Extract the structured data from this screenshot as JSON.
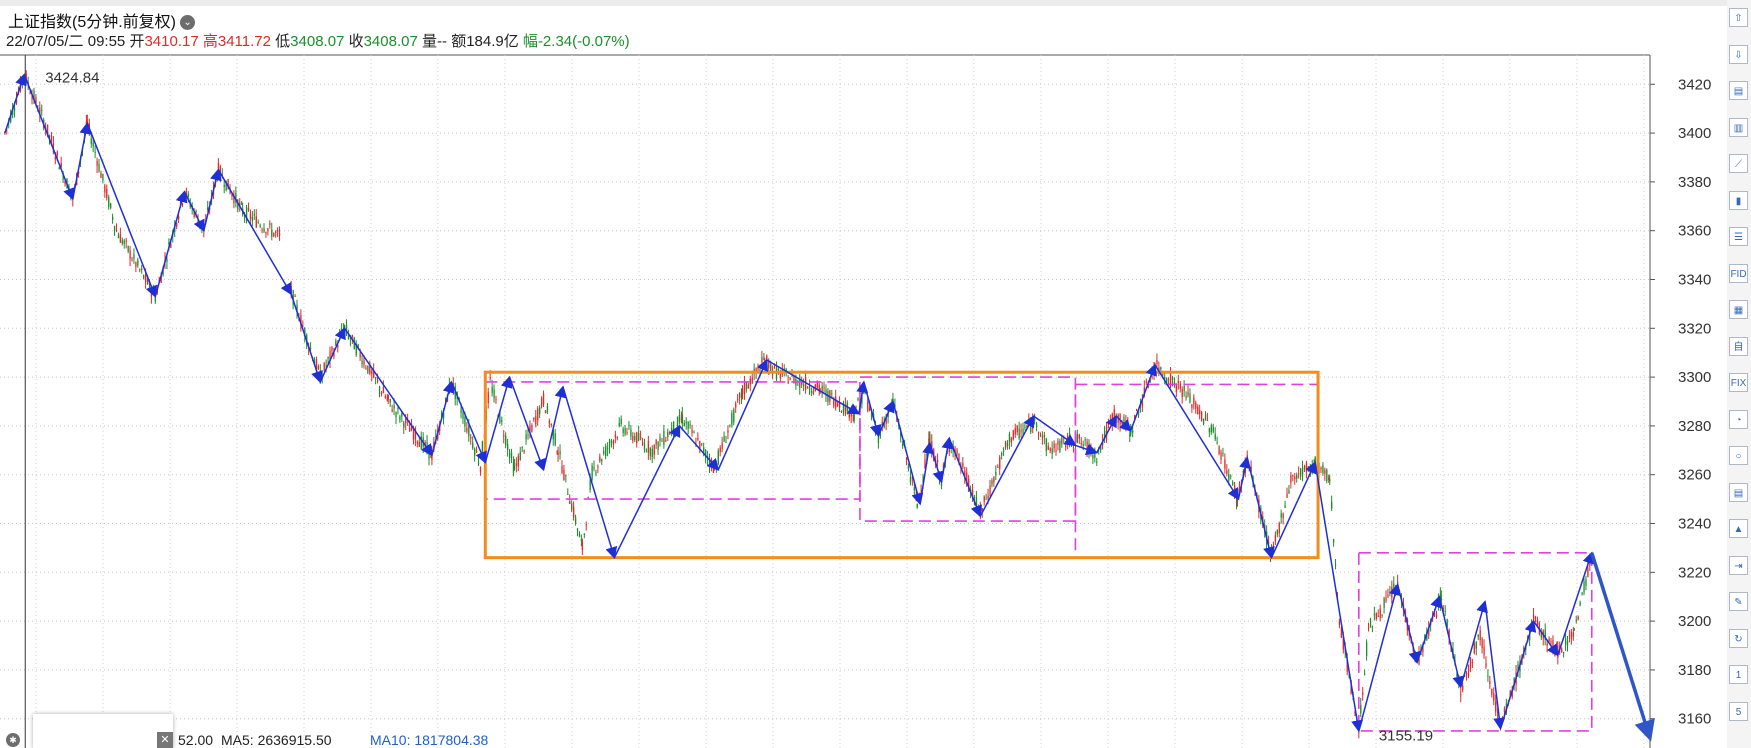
{
  "header": {
    "title": "上证指数(5分钟.前复权)",
    "datetime": "22/07/05/二 09:55",
    "open_label": "开",
    "open": "3410.17",
    "high_label": "高",
    "high": "3411.72",
    "low_label": "低",
    "low": "3408.07",
    "close_label": "收",
    "close": "3408.07",
    "volume_label": "量",
    "volume": "--",
    "amount_label": "额",
    "amount": "184.9亿",
    "change_label": "幅",
    "change": "-2.34(-0.07%)"
  },
  "volume_bar": {
    "partial": "52.00",
    "ma5": "MA5: 2636915.50",
    "ma10": "MA10: 1817804.38"
  },
  "colors": {
    "up": "#e02a2a",
    "down": "#1a8f2a",
    "wave": "#1f2fd6",
    "box": "#f28c1c",
    "dash": "#e040e0",
    "arrow": "#2f55c8"
  },
  "toolbar_items": [
    "⇧",
    "⇩",
    "▤",
    "▥",
    "⟋",
    "▮",
    "☰",
    "FID",
    "▦",
    "自",
    "FIX",
    "◔",
    "○",
    "▤",
    "▲",
    "⇥",
    "✎",
    "↻",
    "1",
    "5"
  ],
  "chart_data": {
    "type": "candlestick",
    "title": "上证指数(5分钟.前复权)",
    "ylim": [
      3148,
      3432
    ],
    "y_ticks": [
      3160,
      3180,
      3200,
      3220,
      3240,
      3260,
      3280,
      3300,
      3320,
      3340,
      3360,
      3380,
      3400,
      3420
    ],
    "grid": true,
    "annotations": [
      {
        "label": "3424.84",
        "x": 26,
        "y": 3424.84
      },
      {
        "label": "3155.19",
        "x": 1400,
        "y": 3155.19
      }
    ],
    "price_path": [
      [
        5,
        3400
      ],
      [
        25,
        3424
      ],
      [
        45,
        3405
      ],
      [
        75,
        3373
      ],
      [
        90,
        3404
      ],
      [
        120,
        3360
      ],
      [
        160,
        3333
      ],
      [
        190,
        3376
      ],
      [
        210,
        3360
      ],
      [
        225,
        3385
      ],
      [
        250,
        3368
      ],
      [
        290,
        3357
      ],
      [
        300,
        3335
      ],
      [
        330,
        3300
      ],
      [
        355,
        3320
      ],
      [
        400,
        3290
      ],
      [
        445,
        3268
      ],
      [
        465,
        3298
      ],
      [
        495,
        3264
      ],
      [
        505,
        3298
      ],
      [
        530,
        3262
      ],
      [
        560,
        3291
      ],
      [
        575,
        3270
      ],
      [
        600,
        3230
      ],
      [
        610,
        3261
      ],
      [
        640,
        3280
      ],
      [
        672,
        3270
      ],
      [
        703,
        3283
      ],
      [
        736,
        3263
      ],
      [
        765,
        3294
      ],
      [
        788,
        3307
      ],
      [
        800,
        3302
      ],
      [
        845,
        3295
      ],
      [
        880,
        3285
      ],
      [
        890,
        3294
      ],
      [
        905,
        3276
      ],
      [
        920,
        3290
      ],
      [
        945,
        3248
      ],
      [
        958,
        3274
      ],
      [
        970,
        3258
      ],
      [
        980,
        3274
      ],
      [
        1010,
        3244
      ],
      [
        1040,
        3275
      ],
      [
        1068,
        3282
      ],
      [
        1080,
        3270
      ],
      [
        1108,
        3275
      ],
      [
        1130,
        3268
      ],
      [
        1148,
        3285
      ],
      [
        1165,
        3278
      ],
      [
        1190,
        3305
      ],
      [
        1220,
        3294
      ],
      [
        1250,
        3278
      ],
      [
        1275,
        3250
      ],
      [
        1285,
        3267
      ],
      [
        1310,
        3226
      ],
      [
        1330,
        3258
      ],
      [
        1355,
        3265
      ],
      [
        1370,
        3258
      ],
      [
        1380,
        3200
      ],
      [
        1400,
        3155
      ],
      [
        1410,
        3197
      ],
      [
        1440,
        3215
      ],
      [
        1460,
        3183
      ],
      [
        1485,
        3210
      ],
      [
        1505,
        3172
      ],
      [
        1525,
        3195
      ],
      [
        1546,
        3156
      ],
      [
        1580,
        3200
      ],
      [
        1605,
        3187
      ],
      [
        1622,
        3196
      ],
      [
        1640,
        3228
      ]
    ],
    "wave_lines": [
      [
        [
          5,
          3400
        ],
        [
          25,
          3424
        ],
        [
          75,
          3373
        ],
        [
          90,
          3404
        ],
        [
          160,
          3333
        ],
        [
          190,
          3376
        ],
        [
          210,
          3360
        ],
        [
          225,
          3385
        ],
        [
          300,
          3334
        ],
        [
          330,
          3298
        ],
        [
          355,
          3320
        ],
        [
          445,
          3268
        ],
        [
          465,
          3298
        ],
        [
          500,
          3265
        ],
        [
          525,
          3300
        ],
        [
          560,
          3262
        ],
        [
          580,
          3296
        ],
        [
          633,
          3226
        ],
        [
          700,
          3280
        ],
        [
          740,
          3262
        ],
        [
          790,
          3307
        ],
        [
          885,
          3285
        ],
        [
          890,
          3298
        ],
        [
          905,
          3276
        ],
        [
          920,
          3290
        ],
        [
          948,
          3248
        ],
        [
          958,
          3273
        ],
        [
          970,
          3257
        ],
        [
          978,
          3275
        ],
        [
          1010,
          3243
        ],
        [
          1065,
          3284
        ],
        [
          1108,
          3272
        ],
        [
          1130,
          3269
        ],
        [
          1150,
          3284
        ],
        [
          1165,
          3278
        ],
        [
          1190,
          3305
        ],
        [
          1276,
          3250
        ],
        [
          1285,
          3267
        ],
        [
          1310,
          3226
        ],
        [
          1355,
          3265
        ],
        [
          1400,
          3155
        ],
        [
          1440,
          3215
        ],
        [
          1460,
          3183
        ],
        [
          1483,
          3210
        ],
        [
          1505,
          3173
        ],
        [
          1530,
          3208
        ],
        [
          1546,
          3156
        ],
        [
          1580,
          3200
        ],
        [
          1605,
          3186
        ],
        [
          1640,
          3228
        ]
      ]
    ],
    "consolidation_box": {
      "x1": 500,
      "x2": 1358,
      "y_top": 3302,
      "y_bottom": 3226
    },
    "dashed_boxes": [
      {
        "x1": 500,
        "x2": 886,
        "y_top": 3298,
        "y_bottom": 3250
      },
      {
        "x1": 886,
        "x2": 1108,
        "y_top": 3300,
        "y_bottom": 3241
      },
      {
        "x1": 1108,
        "x2": 1358,
        "y_top": 3297,
        "y_bottom": 3226
      },
      {
        "x1": 1400,
        "x2": 1640,
        "y_top": 3228,
        "y_bottom": 3155
      }
    ],
    "forecast_arrow": {
      "x1": 1640,
      "y1": 3228,
      "x2": 1700,
      "y2": 3152
    }
  }
}
